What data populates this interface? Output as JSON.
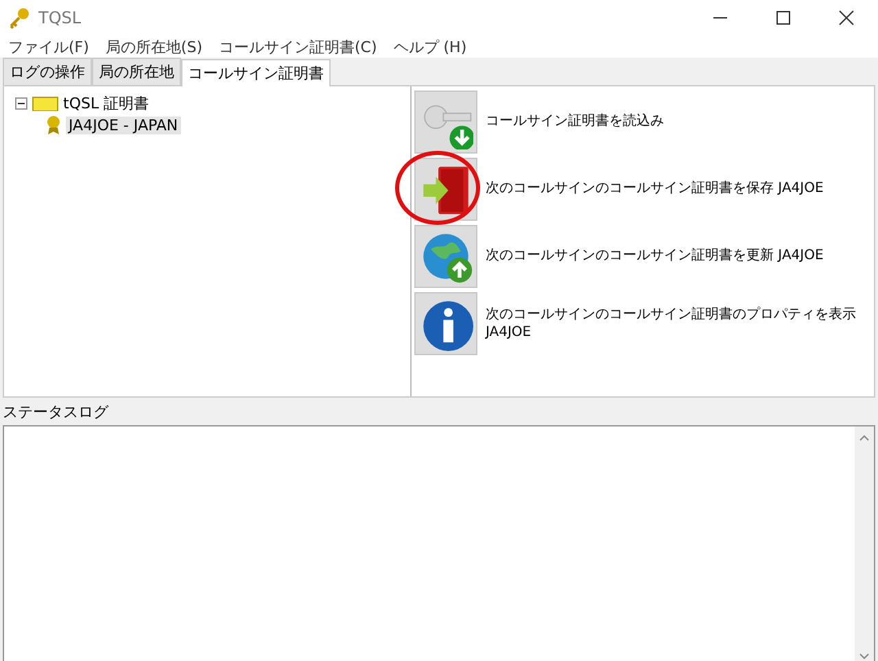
{
  "window": {
    "title": "TQSL"
  },
  "menu": [
    "ファイル(F)",
    "局の所在地(S)",
    "コールサイン証明書(C)",
    "ヘルプ (H)"
  ],
  "tabs": [
    {
      "label": "ログの操作",
      "selected": false
    },
    {
      "label": "局の所在地",
      "selected": false
    },
    {
      "label": "コールサイン証明書",
      "selected": true
    }
  ],
  "tree": [
    {
      "label": "tQSL 証明書",
      "expanded": true,
      "children": [
        {
          "label": "JA4JOE - JAPAN",
          "selected": true
        }
      ]
    }
  ],
  "actions": [
    {
      "kind": "load",
      "label": "コールサイン証明書を読込み",
      "highlighted": false
    },
    {
      "kind": "save",
      "label": "次のコールサインのコールサイン証明書を保存 JA4JOE",
      "highlighted": true
    },
    {
      "kind": "renew",
      "label": "次のコールサインのコールサイン証明書を更新 JA4JOE",
      "highlighted": false
    },
    {
      "kind": "info",
      "label": "次のコールサインのコールサイン証明書のプロパティを表示\nJA4JOE",
      "highlighted": false
    }
  ],
  "status_log": {
    "label": "ステータスログ"
  }
}
